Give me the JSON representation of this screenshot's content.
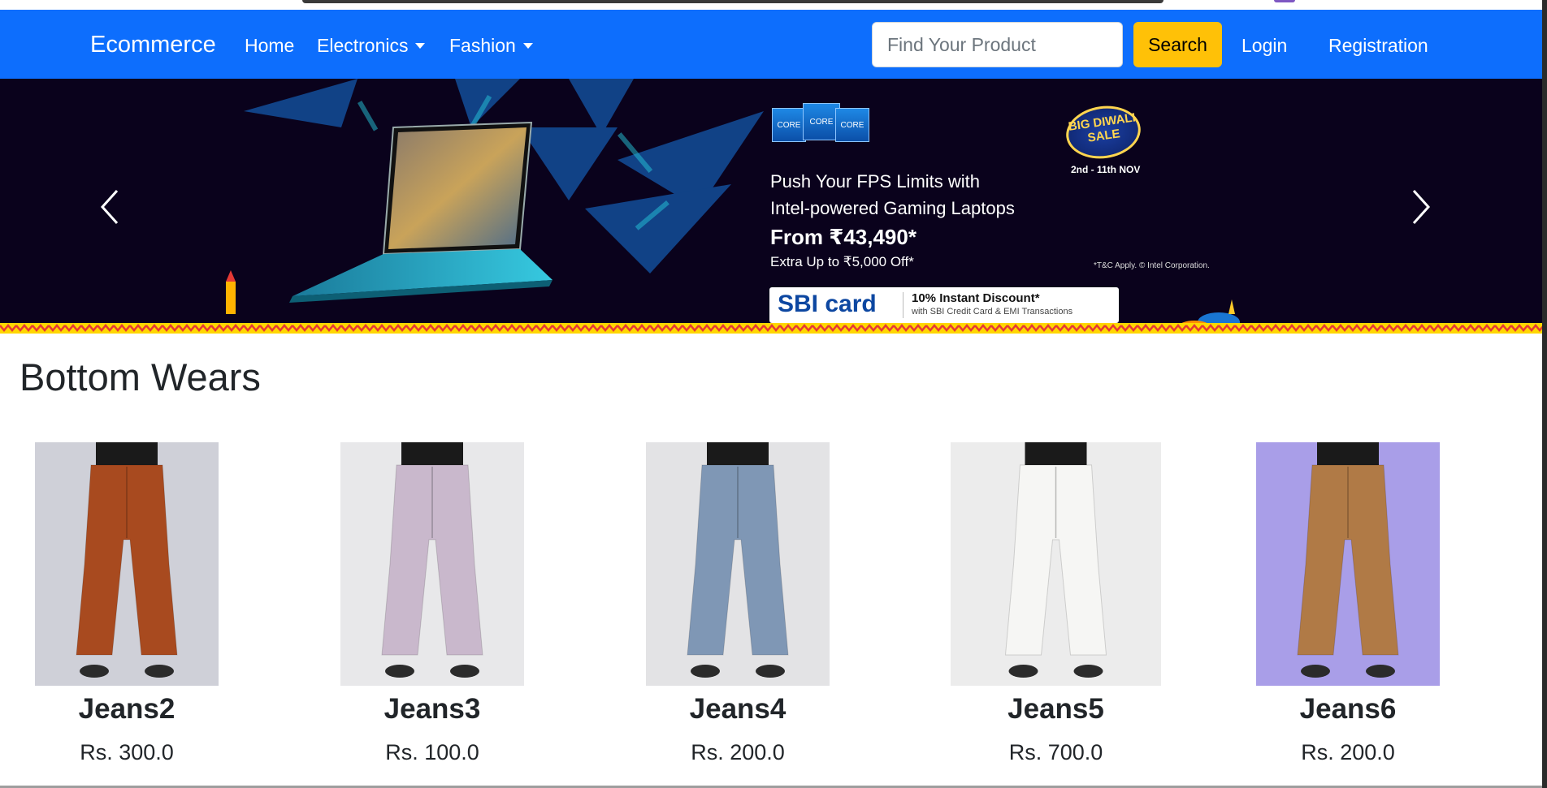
{
  "navbar": {
    "brand": "Ecommerce",
    "links": [
      {
        "label": "Home"
      },
      {
        "label": "Electronics",
        "dropdown": true
      },
      {
        "label": "Fashion",
        "dropdown": true
      }
    ],
    "search": {
      "placeholder": "Find Your Product",
      "value": "",
      "button_label": "Search"
    },
    "login": "Login",
    "registration": "Registration",
    "colors": {
      "navbar": "#0d6efd",
      "search_button": "#ffc107"
    }
  },
  "carousel": {
    "slide": {
      "headline_line1": "Push Your FPS Limits with",
      "headline_line2": "Intel-powered Gaming Laptops",
      "price_line": "From ₹43,490*",
      "offer_line": "Extra Up to ₹5,000 Off*",
      "terms": "*T&C Apply. © Intel Corporation.",
      "sale_badge": "BIG DIWALI SALE",
      "sale_dates": "2nd - 11th NOV",
      "core_badges": [
        "CORE",
        "CORE",
        "CORE"
      ],
      "bank_logo": "SBI card",
      "bank_offer": "10% Instant Discount*",
      "bank_offer_sub": "with SBI Credit Card & EMI Transactions"
    },
    "prev_icon": "chevron-left-icon",
    "next_icon": "chevron-right-icon"
  },
  "section": {
    "title": "Bottom Wears",
    "products": [
      {
        "name": "Jeans2",
        "price": "Rs. 300.0",
        "color": "#a84a1f",
        "bg": "#cfd0d8"
      },
      {
        "name": "Jeans3",
        "price": "Rs. 100.0",
        "color": "#c9b8cc",
        "bg": "#e8e8ea"
      },
      {
        "name": "Jeans4",
        "price": "Rs. 200.0",
        "color": "#7f97b5",
        "bg": "#e3e3e5"
      },
      {
        "name": "Jeans5",
        "price": "Rs. 700.0",
        "color": "#f6f6f4",
        "bg": "#ececec"
      },
      {
        "name": "Jeans6",
        "price": "Rs. 200.0",
        "color": "#b07a46",
        "bg": "#a99ee8"
      }
    ]
  }
}
